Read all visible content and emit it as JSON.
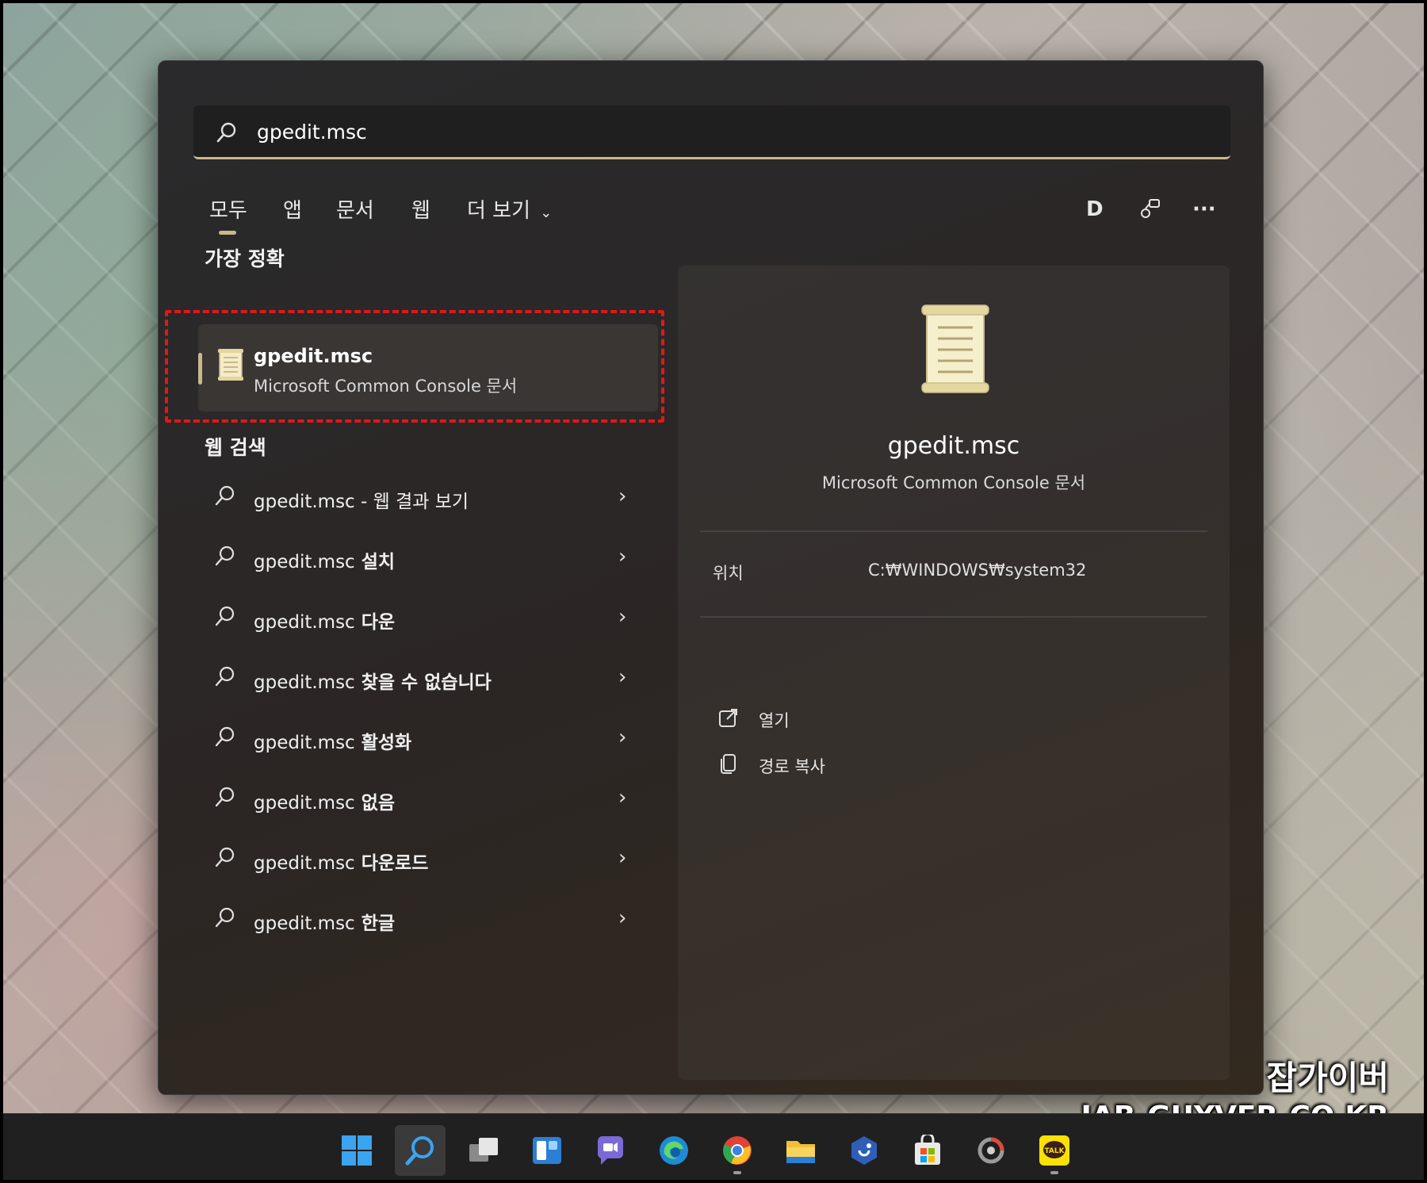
{
  "search": {
    "value": "gpedit.msc"
  },
  "tabs": [
    {
      "label": "모두"
    },
    {
      "label": "앱"
    },
    {
      "label": "문서"
    },
    {
      "label": "웹"
    },
    {
      "label": "더 보기"
    }
  ],
  "header_icons": {
    "account_letter": "D"
  },
  "best_match": {
    "title": "가장 정확",
    "name": "gpedit.msc",
    "subtitle": "Microsoft Common Console 문서"
  },
  "web_search": {
    "title": "웹 검색",
    "items": [
      {
        "prefix": "gpedit.msc",
        "suffix": " - 웹 결과 보기",
        "bold": false
      },
      {
        "prefix": "gpedit.msc",
        "suffix": " 설치",
        "bold": true
      },
      {
        "prefix": "gpedit.msc",
        "suffix": " 다운",
        "bold": true
      },
      {
        "prefix": "gpedit.msc",
        "suffix": " 찾을 수 없습니다",
        "bold": true
      },
      {
        "prefix": "gpedit.msc",
        "suffix": " 활성화",
        "bold": true
      },
      {
        "prefix": "gpedit.msc",
        "suffix": " 없음",
        "bold": true
      },
      {
        "prefix": "gpedit.msc",
        "suffix": " 다운로드",
        "bold": true
      },
      {
        "prefix": "gpedit.msc",
        "suffix": " 한글",
        "bold": true
      }
    ]
  },
  "detail": {
    "name": "gpedit.msc",
    "subtitle": "Microsoft Common Console 문서",
    "location_label": "위치",
    "location_value": "C:₩WINDOWS₩system32",
    "actions": [
      {
        "label": "열기",
        "icon": "open-external-icon"
      },
      {
        "label": "경로 복사",
        "icon": "copy-path-icon"
      }
    ]
  },
  "watermark": {
    "line1": "잡가이버",
    "line2": "JAB-GUYVER.CO.KR"
  },
  "colors": {
    "accent": "#c9b98a",
    "highlight_box": "#e01818"
  }
}
